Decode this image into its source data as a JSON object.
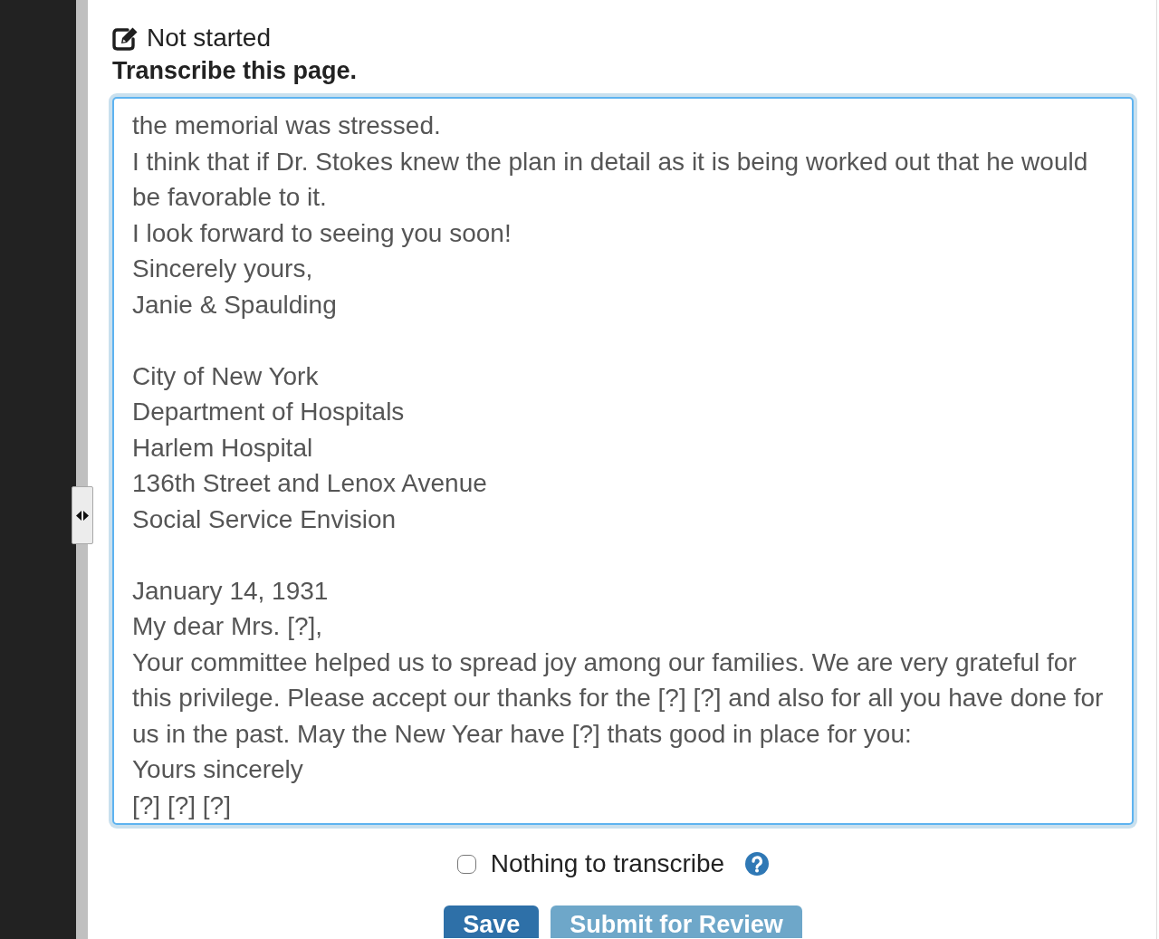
{
  "status": {
    "label": "Not started"
  },
  "instructions": "Transcribe this page.",
  "transcription": {
    "value": "the memorial was stressed.\nI think that if Dr. Stokes knew the plan in detail as it is being worked out that he would be favorable to it.\nI look forward to seeing you soon!\nSincerely yours,\nJanie & Spaulding\n\nCity of New York\nDepartment of Hospitals\nHarlem Hospital\n136th Street and Lenox Avenue\nSocial Service Envision\n\nJanuary 14, 1931\nMy dear Mrs. [?],\nYour committee helped us to spread joy among our families. We are very grateful for this privilege. Please accept our thanks for the [?] [?] and also for all you have done for us in the past. May the New Year have [?] thats good in place for you:\nYours sincerely\n[?] [?] [?]",
    "focused": true
  },
  "nothing_to_transcribe": {
    "label": "Nothing to transcribe",
    "checked": false
  },
  "buttons": [
    {
      "label": "Save",
      "disabled": false
    },
    {
      "label": "Submit for Review",
      "disabled": true
    }
  ]
}
